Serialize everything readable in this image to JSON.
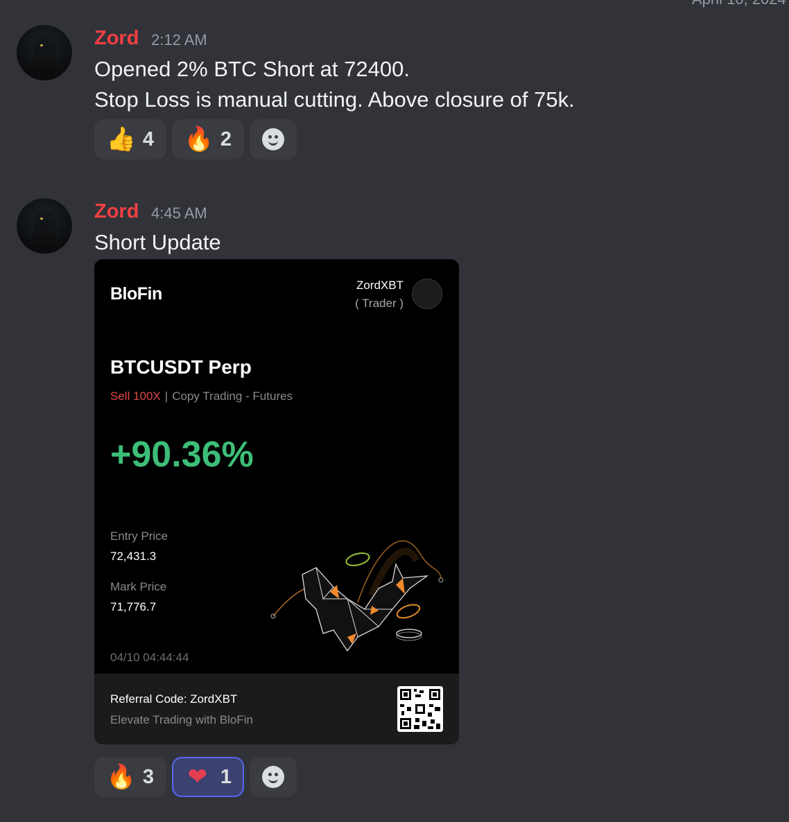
{
  "header": {
    "date_fragment": "April 10, 2024"
  },
  "messages": [
    {
      "author": "Zord",
      "time": "2:12 AM",
      "lines": [
        "Opened 2% BTC Short at 72400.",
        "Stop Loss is manual cutting. Above closure of 75k."
      ],
      "reactions": [
        {
          "emoji": "thumbs-up",
          "glyph": "👍",
          "count": "4",
          "active": false
        },
        {
          "emoji": "fire",
          "glyph": "🔥",
          "count": "2",
          "active": false
        }
      ]
    },
    {
      "author": "Zord",
      "time": "4:45 AM",
      "lines": [
        "Short Update"
      ],
      "reactions": [
        {
          "emoji": "fire",
          "glyph": "🔥",
          "count": "3",
          "active": false
        },
        {
          "emoji": "heart",
          "glyph": "❤",
          "count": "1",
          "active": true
        }
      ]
    }
  ],
  "card": {
    "brand": "BloFin",
    "user": "ZordXBT",
    "role": "( Trader )",
    "pair": "BTCUSDT Perp",
    "side": "Sell 100X",
    "separator": "|",
    "mode": "Copy Trading - Futures",
    "pnl": "+90.36%",
    "entry_label": "Entry Price",
    "entry_value": "72,431.3",
    "mark_label": "Mark Price",
    "mark_value": "71,776.7",
    "timestamp": "04/10 04:44:44",
    "referral": "Referral Code: ZordXBT",
    "tagline": "Elevate Trading with BloFin"
  },
  "colors": {
    "author": "#f23f43",
    "pnl_positive": "#3dbe78",
    "sell": "#e04848",
    "active_reaction_border": "#5865f2"
  }
}
